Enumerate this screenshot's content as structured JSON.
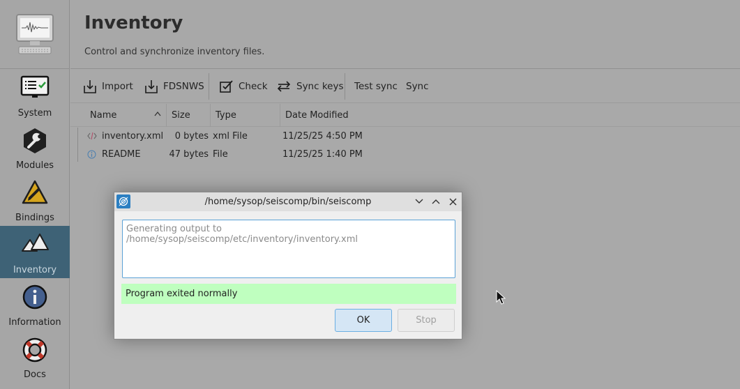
{
  "sidebar": {
    "items": [
      {
        "label": "System",
        "icon": "monitor-check-icon"
      },
      {
        "label": "Modules",
        "icon": "wrench-icon"
      },
      {
        "label": "Bindings",
        "icon": "warning-pencil-icon"
      },
      {
        "label": "Inventory",
        "icon": "mountains-icon",
        "active": true
      },
      {
        "label": "Information",
        "icon": "info-icon"
      },
      {
        "label": "Docs",
        "icon": "lifebuoy-icon"
      }
    ]
  },
  "header": {
    "title": "Inventory",
    "subtitle": "Control and synchronize inventory files."
  },
  "toolbar": {
    "import": "Import",
    "fdsnws": "FDSNWS",
    "check": "Check",
    "sync_keys": "Sync keys",
    "test_sync": "Test sync",
    "sync": "Sync"
  },
  "table": {
    "columns": [
      "Name",
      "Size",
      "Type",
      "Date Modified"
    ],
    "rows": [
      {
        "name": "inventory.xml",
        "size": "0 bytes",
        "type": "xml File",
        "date": "11/25/25 4:50 PM",
        "icon": "code-file-icon"
      },
      {
        "name": "README",
        "size": "47 bytes",
        "type": "File",
        "date": "11/25/25 1:40 PM",
        "icon": "info-file-icon"
      }
    ]
  },
  "dialog": {
    "title": "/home/sysop/seiscomp/bin/seiscomp",
    "output_text": "Generating output to /home/sysop/seiscomp/etc/inventory/inventory.xml",
    "status": "Program exited normally",
    "ok_label": "OK",
    "stop_label": "Stop"
  },
  "colors": {
    "active_sidebar": "#3e6276",
    "status_ok": "#bfffbf",
    "focus_border": "#5aa1d6"
  }
}
